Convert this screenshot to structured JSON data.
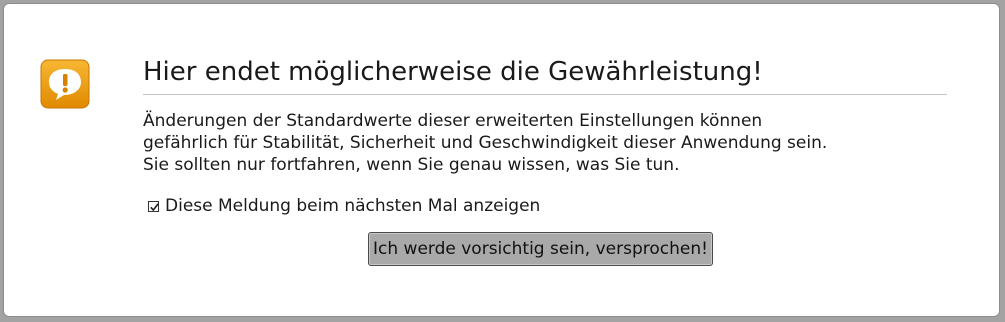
{
  "dialog": {
    "icon": "warning-speech-bubble-icon",
    "icon_color": "#f0a30a",
    "title": "Hier endet möglicherweise die Gewährleistung!",
    "message_lines": [
      "Änderungen der Standardwerte dieser erweiterten Einstellungen können",
      "gefährlich für Stabilität, Sicherheit und Geschwindigkeit dieser Anwendung sein.",
      "Sie sollten nur fortfahren, wenn Sie genau wissen, was Sie tun."
    ],
    "checkbox": {
      "label": "Diese Meldung beim nächsten Mal anzeigen",
      "checked": true
    },
    "button_label": "Ich werde vorsichtig sein, versprochen!"
  }
}
